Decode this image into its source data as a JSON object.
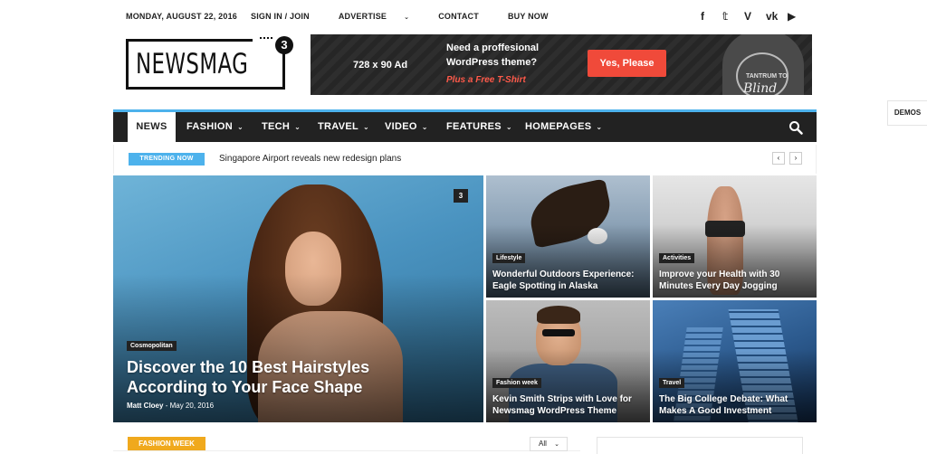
{
  "topbar": {
    "date": "MONDAY, AUGUST 22, 2016",
    "menu": [
      {
        "label": "SIGN IN / JOIN",
        "caret": ""
      },
      {
        "label": "ADVERTISE",
        "caret": "⌄"
      },
      {
        "label": "CONTACT",
        "caret": ""
      },
      {
        "label": "BUY NOW",
        "caret": ""
      }
    ],
    "social": [
      "f",
      "𝕥",
      "V",
      "vk",
      "▶"
    ]
  },
  "logo": {
    "text": "NEWSMAG",
    "badge": "3"
  },
  "ad": {
    "size": "728 x 90 Ad",
    "line1": "Need a proffesional",
    "line2": "WordPress theme?",
    "line3": "Plus a Free T-Shirt",
    "button": "Yes, Please",
    "shirt_text": "TANTRUM TO",
    "shirt_script": "Blind"
  },
  "demos": "DEMOS",
  "nav": {
    "items": [
      {
        "label": "NEWS",
        "caret": ""
      },
      {
        "label": "FASHION",
        "caret": "⌄"
      },
      {
        "label": "TECH",
        "caret": "⌄"
      },
      {
        "label": "TRAVEL",
        "caret": "⌄"
      },
      {
        "label": "VIDEO",
        "caret": "⌄"
      },
      {
        "label": "FEATURES",
        "caret": "⌄"
      },
      {
        "label": "HOMEPAGES",
        "caret": "⌄"
      }
    ],
    "search_icon": "search-icon"
  },
  "trending": {
    "tag": "TRENDING NOW",
    "headline": "Singapore Airport reveals new redesign plans",
    "prev": "‹",
    "next": "›"
  },
  "featured": {
    "big": {
      "category": "Cosmopolitan",
      "title": "Discover the 10 Best Hairstyles According to Your Face Shape",
      "author": "Matt Cloey",
      "date": "May 20, 2016",
      "comments": "3"
    },
    "small": [
      {
        "category": "Lifestyle",
        "title": "Wonderful Outdoors Experience: Eagle Spotting in Alaska"
      },
      {
        "category": "Activities",
        "title": "Improve your Health with 30 Minutes Every Day Jogging"
      },
      {
        "category": "Fashion week",
        "title": "Kevin Smith Strips with Love for Newsmag WordPress Theme"
      },
      {
        "category": "Travel",
        "title": "The Big College Debate: What Makes A Good Investment"
      }
    ]
  },
  "bottom": {
    "section_tag": "FASHION WEEK",
    "filter_value": "All",
    "filter_caret": "⌄"
  },
  "colors": {
    "accent": "#4db2ec",
    "nav_bg": "#222222",
    "ad_button": "#f04a3a",
    "section_tag": "#f0a91d"
  }
}
